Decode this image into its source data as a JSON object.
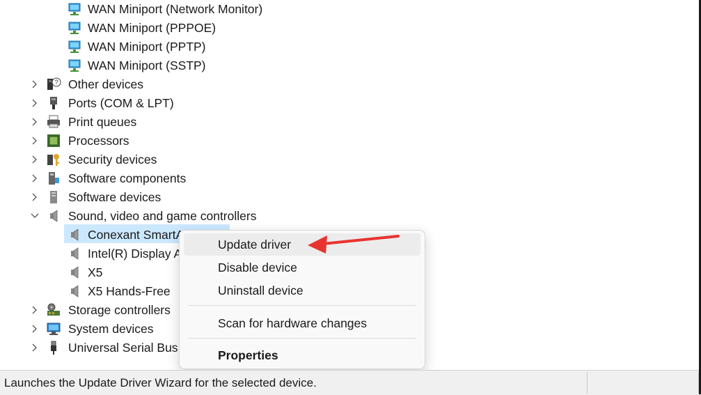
{
  "tree": {
    "items": [
      {
        "label": "WAN Miniport (Network Monitor)",
        "level": 2,
        "icon": "network-adapter-icon"
      },
      {
        "label": "WAN Miniport (PPPOE)",
        "level": 2,
        "icon": "network-adapter-icon"
      },
      {
        "label": "WAN Miniport (PPTP)",
        "level": 2,
        "icon": "network-adapter-icon"
      },
      {
        "label": "WAN Miniport (SSTP)",
        "level": 2,
        "icon": "network-adapter-icon"
      },
      {
        "label": "Other devices",
        "level": 1,
        "icon": "unknown-device-icon",
        "expanded": false
      },
      {
        "label": "Ports (COM & LPT)",
        "level": 1,
        "icon": "port-icon",
        "expanded": false
      },
      {
        "label": "Print queues",
        "level": 1,
        "icon": "printer-icon",
        "expanded": false
      },
      {
        "label": "Processors",
        "level": 1,
        "icon": "processor-icon",
        "expanded": false
      },
      {
        "label": "Security devices",
        "level": 1,
        "icon": "security-key-icon",
        "expanded": false
      },
      {
        "label": "Software components",
        "level": 1,
        "icon": "software-component-icon",
        "expanded": false
      },
      {
        "label": "Software devices",
        "level": 1,
        "icon": "software-device-icon",
        "expanded": false
      },
      {
        "label": "Sound, video and game controllers",
        "level": 1,
        "icon": "speaker-icon",
        "expanded": true
      },
      {
        "label": "Conexant SmartA",
        "level": 2,
        "icon": "speaker-icon",
        "selected": true
      },
      {
        "label": "Intel(R) Display A",
        "level": 2,
        "icon": "speaker-icon"
      },
      {
        "label": "X5",
        "level": 2,
        "icon": "speaker-icon"
      },
      {
        "label": "X5 Hands-Free",
        "level": 2,
        "icon": "speaker-icon"
      },
      {
        "label": "Storage controllers",
        "level": 1,
        "icon": "storage-controller-icon",
        "expanded": false
      },
      {
        "label": "System devices",
        "level": 1,
        "icon": "system-device-icon",
        "expanded": false
      },
      {
        "label": "Universal Serial Bus c",
        "level": 1,
        "icon": "usb-icon",
        "expanded": false
      }
    ]
  },
  "context_menu": {
    "items": [
      {
        "label": "Update driver",
        "hover": true
      },
      {
        "label": "Disable device"
      },
      {
        "label": "Uninstall device"
      },
      {
        "label": "Scan for hardware changes"
      },
      {
        "label": "Properties",
        "bold": true
      }
    ]
  },
  "status_bar": {
    "text": "Launches the Update Driver Wizard for the selected device."
  },
  "colors": {
    "selection": "#cce8ff",
    "annotation_arrow": "#e8342f",
    "menu_hover": "#ececec"
  }
}
